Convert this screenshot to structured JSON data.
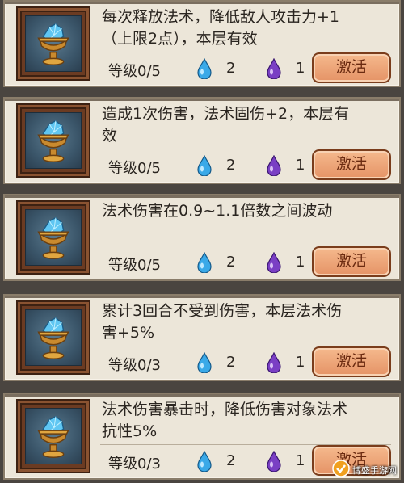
{
  "skills": [
    {
      "desc_line1": "每次释放法术，降低敌人攻击力+1",
      "desc_line2": "（上限2点），本层有效",
      "level_label": "等级0/5",
      "blue_cost": "2",
      "purple_cost": "1",
      "button": "激活"
    },
    {
      "desc_line1": "造成1次伤害，法术固伤+2，本层有",
      "desc_line2": "效",
      "level_label": "等级0/5",
      "blue_cost": "2",
      "purple_cost": "1",
      "button": "激活"
    },
    {
      "desc_line1": "法术伤害在0.9~1.1倍数之间波动",
      "desc_line2": "",
      "level_label": "等级0/5",
      "blue_cost": "2",
      "purple_cost": "1",
      "button": "激活"
    },
    {
      "desc_line1": "累计3回合不受到伤害，本层法术伤",
      "desc_line2": "害+5%",
      "level_label": "等级0/3",
      "blue_cost": "2",
      "purple_cost": "1",
      "button": "激活"
    },
    {
      "desc_line1": "法术伤害暴击时，降低伤害对象法术",
      "desc_line2": "抗性5%",
      "level_label": "等级0/3",
      "blue_cost": "2",
      "purple_cost": "1",
      "button": "激活"
    }
  ],
  "icons": {
    "skill": "goblet-crystal-icon",
    "blue": "blue-drop-icon",
    "purple": "purple-drop-icon"
  },
  "colors": {
    "blue_drop": "#3aa9e8",
    "purple_drop": "#7a3fc4",
    "button": "#eea175"
  },
  "watermark": {
    "text": "博盛手游网"
  }
}
